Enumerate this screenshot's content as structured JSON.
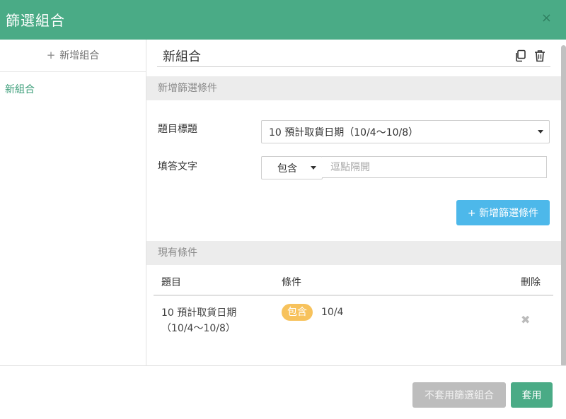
{
  "dialog": {
    "title": "篩選組合",
    "close_glyph": "×"
  },
  "sidebar": {
    "add_plus": "+",
    "add_label": "新增組合",
    "items": [
      {
        "label": "新組合",
        "active": true
      }
    ]
  },
  "editor": {
    "name_value": "新組合",
    "icons": [
      "copy-icon",
      "trash-icon"
    ],
    "new_condition_section": "新增篩選條件",
    "question_label": "題目標題",
    "question_selected": "10 預計取貨日期（10/4～10/8）",
    "answer_label": "填答文字",
    "operator_selected": "包含",
    "answer_placeholder": "逗點隔開",
    "add_condition_button": "+ 新增篩選條件",
    "existing_section": "現有條件"
  },
  "conditions_table": {
    "headers": {
      "question": "題目",
      "condition": "條件",
      "delete": "刪除"
    },
    "rows": [
      {
        "question_line1": "10 預計取貨日期",
        "question_line2": "（10/4～10/8）",
        "operator": "包含",
        "value": "10/4",
        "delete_glyph": "✖"
      }
    ]
  },
  "footer": {
    "disabled_button": "不套用篩選組合",
    "apply_button": "套用"
  },
  "colors": {
    "header": "#4aab86",
    "primary_blue": "#4db8ea",
    "badge": "#f7c25c",
    "disabled": "#bdbdbd"
  }
}
